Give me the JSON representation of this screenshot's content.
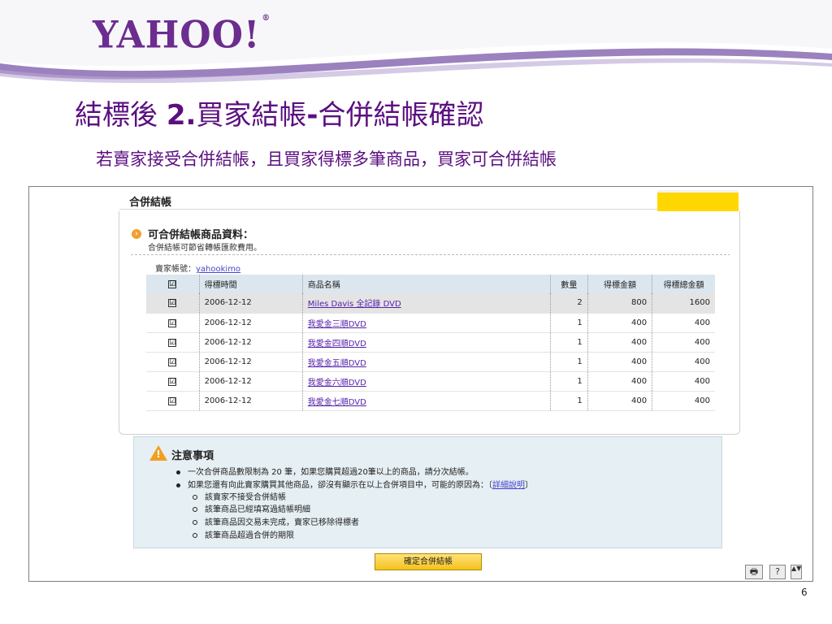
{
  "brand": {
    "logo_text": "YAHOO!",
    "logo_mark": "®",
    "accent_color": "#5b0f80"
  },
  "slide": {
    "title_prefix": "結標後 ",
    "title_bold": "2.",
    "title_main": "買家結帳",
    "title_dash": "-",
    "title_suffix": "合併結帳確認",
    "subtitle": "若賣家接受合併結帳，且買家得標多筆商品，買家可合併結帳",
    "page_number": "6"
  },
  "panel": {
    "title": "合併結帳",
    "section_heading": "可合併結帳商品資料：",
    "section_note": "合併結帳可節省轉帳匯款費用。",
    "seller_label": "賣家帳號：",
    "seller_id": "yahookimo"
  },
  "table": {
    "headers": {
      "check": "☑",
      "date": "得標時間",
      "name": "商品名稱",
      "qty": "數量",
      "bid": "得標金額",
      "total": "得標總金額"
    },
    "rows": [
      {
        "checked": "☑",
        "date": "2006-12-12",
        "name": "Miles Davis 全記錄 DVD",
        "qty": "2",
        "bid": "800",
        "total": "1600"
      },
      {
        "checked": "☑",
        "date": "2006-12-12",
        "name": "我愛金三順DVD",
        "qty": "1",
        "bid": "400",
        "total": "400"
      },
      {
        "checked": "☑",
        "date": "2006-12-12",
        "name": "我愛金四順DVD",
        "qty": "1",
        "bid": "400",
        "total": "400"
      },
      {
        "checked": "☑",
        "date": "2006-12-12",
        "name": "我愛金五順DVD",
        "qty": "1",
        "bid": "400",
        "total": "400"
      },
      {
        "checked": "☑",
        "date": "2006-12-12",
        "name": "我愛金六順DVD",
        "qty": "1",
        "bid": "400",
        "total": "400"
      },
      {
        "checked": "☑",
        "date": "2006-12-12",
        "name": "我愛金七順DVD",
        "qty": "1",
        "bid": "400",
        "total": "400"
      }
    ]
  },
  "notice": {
    "heading": "注意事項",
    "bullet_1": "一次合併商品數限制為 20 筆，如果您購買超過20筆以上的商品，請分次結帳。",
    "bullet_2_text": "如果您還有向此賣家購買其他商品，卻沒有顯示在以上合併項目中，可能的原因為：〔",
    "bullet_2_link": "詳細說明",
    "bullet_2_end": "〕",
    "reasons": [
      "該賣家不接受合併結帳",
      "該筆商品已經填寫過結帳明細",
      "該筆商品因交易未完成，賣家已移除得標者",
      "該筆商品超過合併的期限"
    ]
  },
  "actions": {
    "confirm_label": "確定合併結帳"
  },
  "toolbar": {
    "print_glyph": "🖶",
    "help_glyph": "?",
    "scroll_glyph": "▲▼"
  }
}
